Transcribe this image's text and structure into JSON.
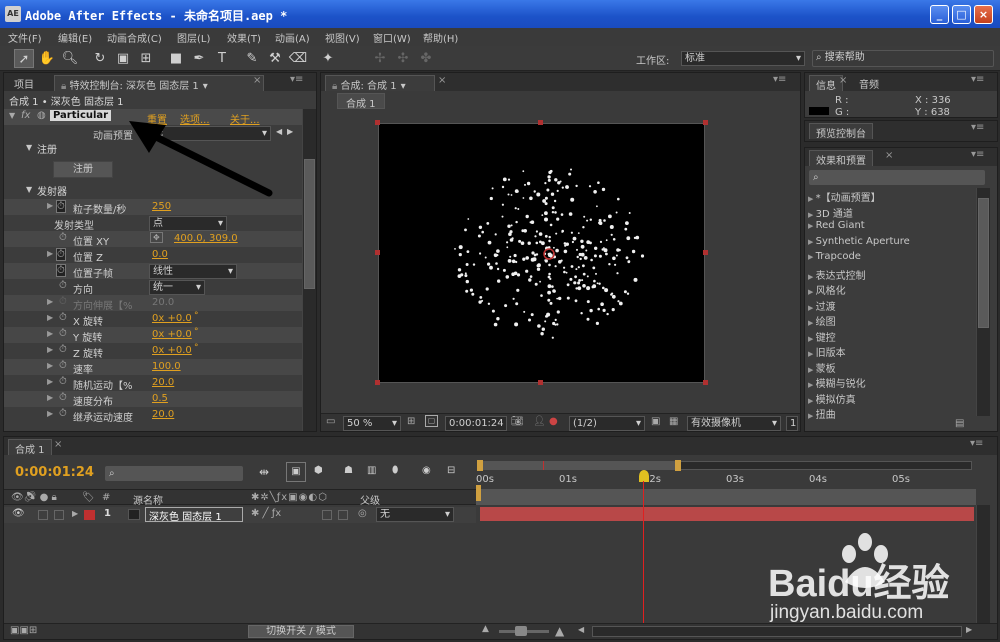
{
  "window": {
    "title": "Adobe After Effects - 未命名项目.aep *",
    "app_icon": "AE",
    "buttons": [
      "_",
      "□",
      "×"
    ]
  },
  "menu": [
    "文件(F)",
    "编辑(E)",
    "动画合成(C)",
    "图层(L)",
    "效果(T)",
    "动画(A)",
    "视图(V)",
    "窗口(W)",
    "帮助(H)"
  ],
  "toolbar": {
    "workspace_label": "工作区:",
    "workspace_value": "标准",
    "search_placeholder": "搜索帮助"
  },
  "left_panel": {
    "tab_project": "项目",
    "tab_effects": "特效控制台: 深灰色 固态层 1",
    "breadcrumb": "合成 1 • 深灰色 固态层 1",
    "effect_name": "Particular",
    "effect_links": [
      "重置",
      "选项...",
      "关于..."
    ],
    "preset_label": "动画预置",
    "preset_value": "无",
    "register_group": "注册",
    "register_button": "注册",
    "emitter_group": "发射器",
    "props": [
      {
        "label": "粒子数量/秒",
        "value": "250"
      },
      {
        "label": "发射类型",
        "value": "点"
      },
      {
        "label": "位置 XY",
        "value": "400.0, 309.0"
      },
      {
        "label": "位置 Z",
        "value": "0.0"
      },
      {
        "label": "位置子帧",
        "value": "线性"
      },
      {
        "label": "方向",
        "value": "统一"
      },
      {
        "label": "方向伸展【%",
        "value": "20.0"
      },
      {
        "label": "X 旋转",
        "value": "0x +0.0"
      },
      {
        "label": "Y 旋转",
        "value": "0x +0.0"
      },
      {
        "label": "Z 旋转",
        "value": "0x +0.0"
      },
      {
        "label": "速率",
        "value": "100.0"
      },
      {
        "label": "随机运动【%",
        "value": "20.0"
      },
      {
        "label": "速度分布",
        "value": "0.5"
      },
      {
        "label": "继承运动速度",
        "value": "20.0"
      }
    ],
    "degree_mark": "°"
  },
  "comp_panel": {
    "tab": "合成: 合成 1",
    "subtab": "合成 1",
    "zoom": "50 %",
    "timecode": "0:00:01:24",
    "resolution": "(1/2)",
    "camera": "有效摄像机",
    "views": "1"
  },
  "info_panel": {
    "tab_info": "信息",
    "tab_audio": "音频",
    "r": "R :",
    "g": "G :",
    "x": "X : 336",
    "y": "Y : 638"
  },
  "preview_panel": {
    "tab": "预览控制台"
  },
  "effects_panel": {
    "tab": "效果和预置",
    "items": [
      "*【动画预置】",
      "3D 通道",
      "Red Giant",
      "Synthetic Aperture",
      "Trapcode",
      "表达式控制",
      "风格化",
      "过渡",
      "绘图",
      "键控",
      "旧版本",
      "蒙板",
      "模糊与锐化",
      "模拟仿真",
      "扭曲"
    ]
  },
  "timeline": {
    "tab": "合成 1",
    "timecode": "0:00:01:24",
    "col_source": "源名称",
    "col_parent": "父级",
    "ruler": [
      "00s",
      "01s",
      "02s",
      "03s",
      "04s",
      "05s"
    ],
    "layer": {
      "index": "1",
      "name": "深灰色 固态层 1",
      "parent": "无"
    },
    "bottom_button": "切换开关 / 模式"
  },
  "watermark": {
    "brand": "Baidu经验",
    "url": "jingyan.baidu.com"
  },
  "colors": {
    "titlebar": "#1c52c8",
    "panel": "#3c3c3c",
    "accent": "#e0a020",
    "layer_bar": "#b84848",
    "playhead": "#e02020"
  }
}
